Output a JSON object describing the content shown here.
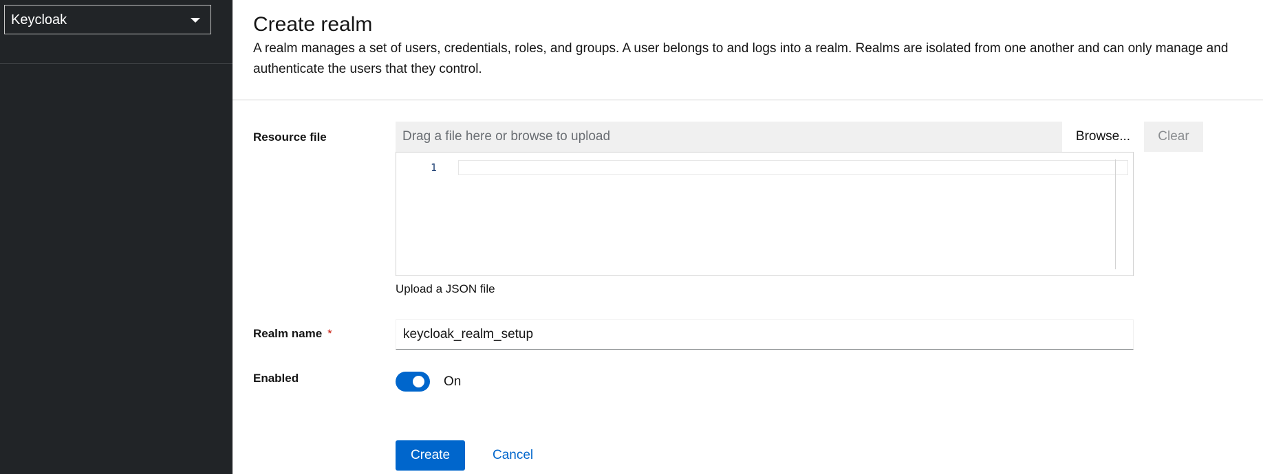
{
  "sidebar": {
    "realm_selector": {
      "label": "Keycloak",
      "icon": "caret-down-icon"
    }
  },
  "header": {
    "title": "Create realm",
    "description": "A realm manages a set of users, credentials, roles, and groups. A user belongs to and logs into a realm. Realms are isolated from one another and can only manage and\nauthenticate the users that they control."
  },
  "form": {
    "resource_file": {
      "label": "Resource file",
      "placeholder": "Drag a file here or browse to upload",
      "browse_label": "Browse...",
      "clear_label": "Clear",
      "editor_line_number": "1",
      "helper_text": "Upload a JSON file"
    },
    "realm_name": {
      "label": "Realm name",
      "required_marker": "*",
      "value": "keycloak_realm_setup"
    },
    "enabled": {
      "label": "Enabled",
      "state_label": "On",
      "checked": true
    }
  },
  "actions": {
    "create_label": "Create",
    "cancel_label": "Cancel"
  },
  "colors": {
    "sidebar_bg": "#212427",
    "primary": "#0066cc",
    "required": "#c9190b"
  }
}
